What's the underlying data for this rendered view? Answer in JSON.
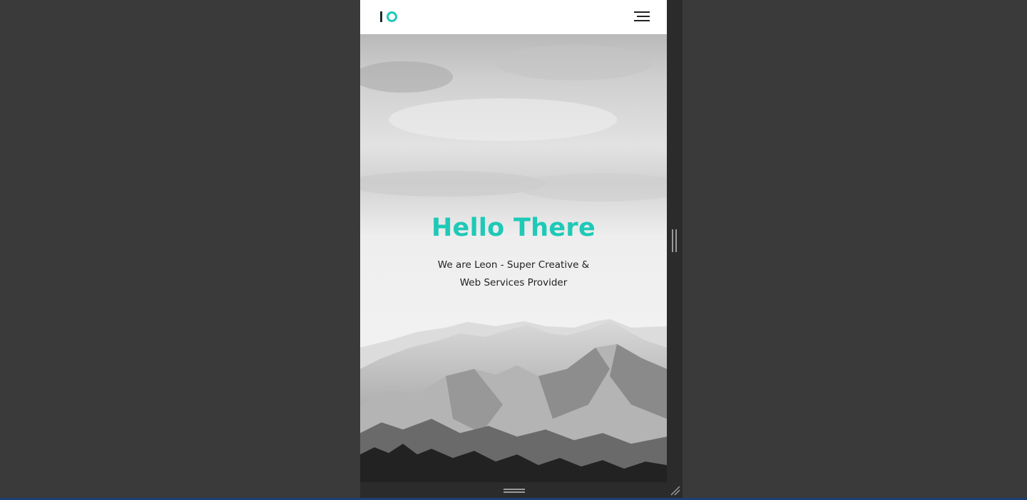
{
  "navbar": {
    "logo_name": "io-logo",
    "menu_icon": "hamburger-menu-icon",
    "brand_color": "#1ec9b7"
  },
  "hero": {
    "title": "Hello There",
    "subtitle_line1": "We are Leon - Super Creative &",
    "subtitle_line2": "Web Services Provider",
    "title_color": "#1ec9b7",
    "background": "monochrome mountain photo"
  },
  "viewport_frame": {
    "bottom_handle_icon": "resize-handle-horizontal-icon",
    "side_handle_icon": "resize-handle-vertical-icon",
    "corner_icon": "resize-corner-icon"
  }
}
